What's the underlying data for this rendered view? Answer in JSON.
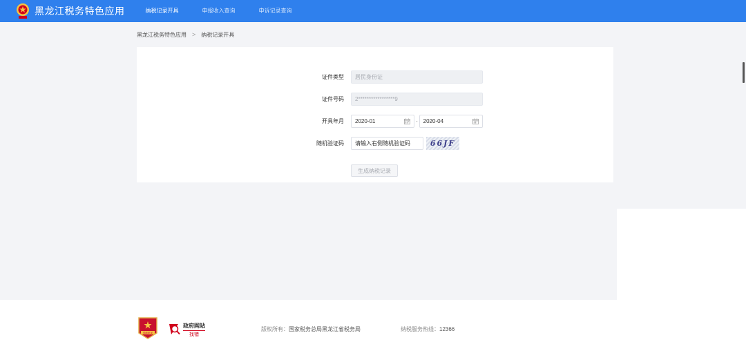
{
  "header": {
    "app_title": "黑龙江税务特色应用",
    "nav": [
      {
        "label": "纳税记录开具",
        "active": true
      },
      {
        "label": "申报收入查询",
        "active": false
      },
      {
        "label": "申诉记录查询",
        "active": false
      }
    ],
    "brand_color": "#2f80ed"
  },
  "breadcrumb": {
    "root": "黑龙江税务特色应用",
    "separator": ">",
    "current": "纳税记录开具"
  },
  "form": {
    "id_type": {
      "label": "证件类型",
      "value": "居民身份证"
    },
    "id_number": {
      "label": "证件号码",
      "value": "2*****************9"
    },
    "period": {
      "label": "开具年月",
      "start": "2020-01",
      "separator": "-",
      "end": "2020-04"
    },
    "captcha": {
      "label": "随机验证码",
      "placeholder": "请输入右侧随机验证码",
      "image_text": "66JF"
    },
    "submit_label": "生成纳税记录"
  },
  "footer": {
    "gov_site_line1": "政府网站",
    "gov_site_line2": "找错",
    "badge_text": "党政机关",
    "copyright_label": "版权所有：",
    "copyright_value": "国家税务总局黑龙江省税务局",
    "hotline_label": "纳税服务热线：",
    "hotline_value": "12366"
  }
}
